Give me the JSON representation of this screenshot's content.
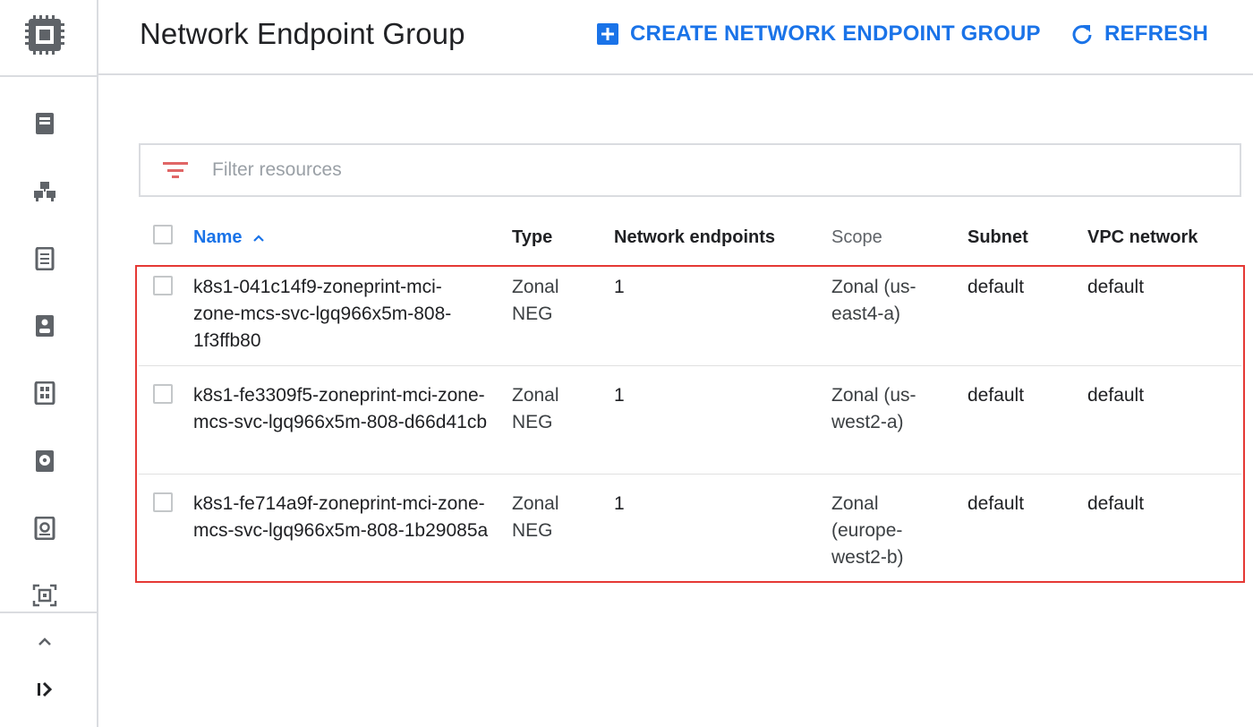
{
  "page": {
    "title": "Network Endpoint Group"
  },
  "toolbar": {
    "create_label": "CREATE NETWORK ENDPOINT GROUP",
    "refresh_label": "REFRESH"
  },
  "filter": {
    "placeholder": "Filter resources"
  },
  "colors": {
    "accent": "#1a73e8",
    "highlight": "#e53935",
    "divider": "#dadce0",
    "icon": "#5f6368"
  },
  "sidebar": {
    "icons": [
      "compute-chip-icon",
      "vm-instance-icon",
      "instance-group-icon",
      "instance-template-icon",
      "sole-tenant-icon",
      "machine-image-icon",
      "disk-icon",
      "snapshot-icon",
      "image-icon",
      "more-icon",
      "expand-icon"
    ]
  },
  "table": {
    "columns": {
      "name": "Name",
      "type": "Type",
      "endpoints": "Network endpoints",
      "scope": "Scope",
      "subnet": "Subnet",
      "vpc": "VPC network"
    },
    "rows": [
      {
        "name": "k8s1-041c14f9-zoneprint-mci-zone-mcs-svc-lgq966x5m-808-1f3ffb80",
        "type": "Zonal NEG",
        "endpoints": "1",
        "scope": "Zonal (us-east4-a)",
        "subnet": "default",
        "vpc": "default"
      },
      {
        "name": "k8s1-fe3309f5-zoneprint-mci-zone-mcs-svc-lgq966x5m-808-d66d41cb",
        "type": "Zonal NEG",
        "endpoints": "1",
        "scope": "Zonal (us-west2-a)",
        "subnet": "default",
        "vpc": "default"
      },
      {
        "name": "k8s1-fe714a9f-zoneprint-mci-zone-mcs-svc-lgq966x5m-808-1b29085a",
        "type": "Zonal NEG",
        "endpoints": "1",
        "scope": "Zonal (europe-west2-b)",
        "subnet": "default",
        "vpc": "default"
      }
    ]
  }
}
